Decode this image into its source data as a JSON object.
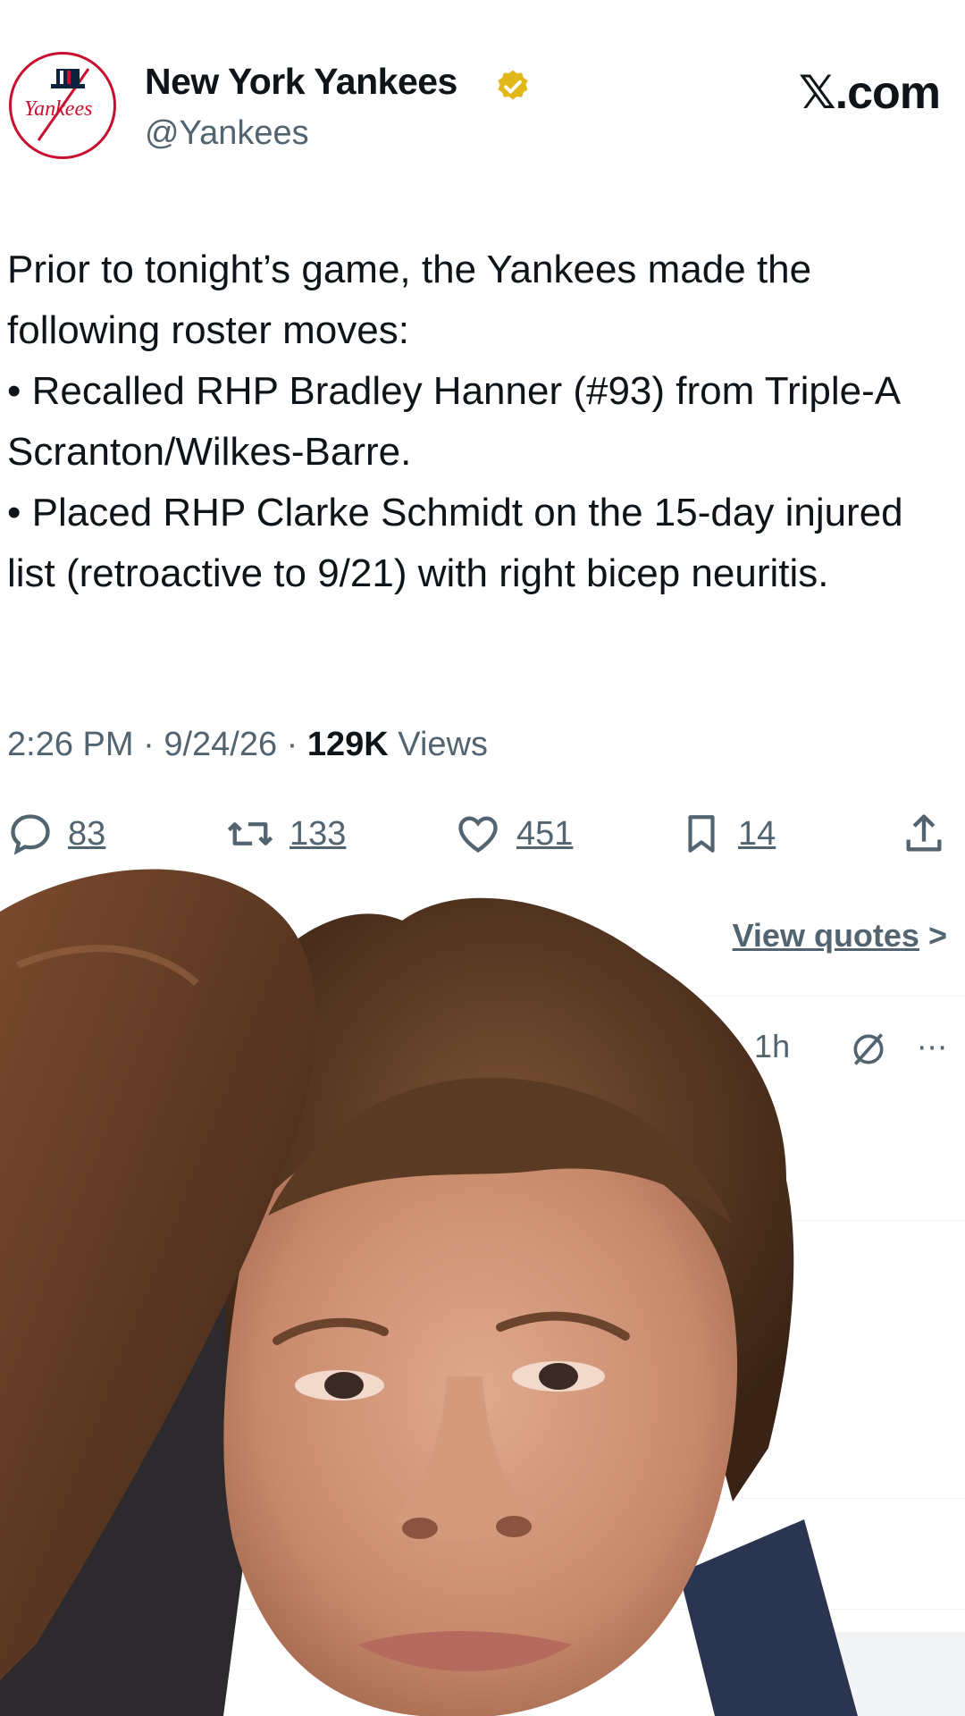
{
  "account": {
    "name": "New York Yankees",
    "handle": "@Yankees",
    "logo_text": "Yankees"
  },
  "brand": "𝕏.com",
  "tweet": {
    "text": "Prior to tonight’s game, the Yankees made the following roster moves:\n• Recalled RHP Bradley Hanner (#93) from Triple-A Scranton/Wilkes-Barre.\n• Placed RHP Clarke Schmidt on the 15-day injured list (retroactive to 9/21) with right bicep neuritis.",
    "time": "2:26 PM",
    "date": "9/24/26",
    "views_count": "129K",
    "views_label": "Views",
    "separator": "·"
  },
  "actions": {
    "replies": "83",
    "reposts": "133",
    "likes": "451",
    "bookmarks": "14"
  },
  "view_quotes": {
    "label": "View quotes",
    "chevron": ">"
  },
  "replies": [
    {
      "meta": "draa · 1h"
    }
  ],
  "colors": {
    "accent_red": "#c8102e",
    "navy": "#0c2340",
    "text_secondary": "#536471",
    "verified_gold": "#e2b719"
  },
  "icons": [
    "reply-icon",
    "repost-icon",
    "like-icon",
    "bookmark-icon",
    "share-icon",
    "grok-icon",
    "more-icon",
    "verified-icon"
  ]
}
